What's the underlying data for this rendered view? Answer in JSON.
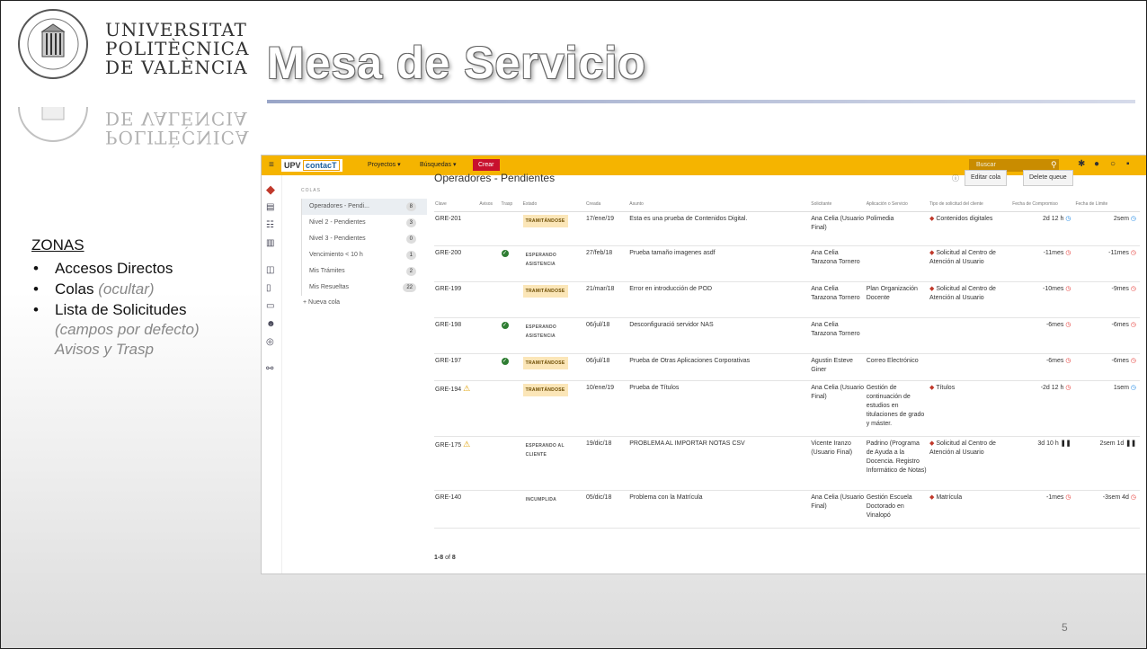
{
  "header": {
    "university_lines": [
      "UNIVERSITAT",
      "POLITÈCNICA",
      "DE VALÈNCIA"
    ],
    "seal_text": "UNIVERSITAT POLITÈCNICA DE VALÈNCIA",
    "title": "Mesa de Servicio"
  },
  "zones": {
    "heading": "ZONAS",
    "item1": "Accesos Directos",
    "item2": "Colas",
    "item2_note": "(ocultar)",
    "item3": "Lista de Solicitudes",
    "item3_note1": "(campos por defecto)",
    "item3_note2": "Avisos y Trasp"
  },
  "slide_number": "5",
  "app": {
    "brand_prefix": "UPV",
    "brand_name": "contacT",
    "nav": {
      "proyectos": "Proyectos ▾",
      "busquedas": "Búsquedas ▾",
      "crear": "Crear"
    },
    "search_placeholder": "Buscar",
    "queues_label": "COLAS",
    "queues": [
      {
        "name": "Operadores - Pendi...",
        "count": "8"
      },
      {
        "name": "Nivel 2 - Pendientes",
        "count": "3"
      },
      {
        "name": "Nivel 3 - Pendientes",
        "count": "0"
      },
      {
        "name": "Vencimiento < 10 h",
        "count": "1"
      },
      {
        "name": "Mis Trámites",
        "count": "2"
      },
      {
        "name": "Mis Resueltas",
        "count": "22"
      }
    ],
    "new_queue": "+ Nueva cola",
    "main_title": "Operadores - Pendientes",
    "edit_button": "Editar cola",
    "delete_button": "Delete queue",
    "columns": [
      "Clave",
      "Avisos",
      "Trasp",
      "Estado",
      "Creada",
      "Asunto",
      "Solicitante",
      "Aplicación o Servicio",
      "Tipo de solicitud del cliente",
      "Fecha de Compromiso",
      "Fecha de Límite"
    ],
    "rows": [
      {
        "key": "GRE-201",
        "aviso": "",
        "trasp": "",
        "estado": "TRAMITÁNDOSE",
        "creada": "17/ene/19",
        "asunto": "Esta es una prueba de Contenidos Digital.",
        "solicitante": "Ana Celia (Usuario Final)",
        "aplicacion": "Polimedia",
        "tipo": "Contenidos digitales",
        "compromiso": "2d 12 h",
        "limite": "2sem"
      },
      {
        "key": "GRE-200",
        "aviso": "",
        "trasp": "ok",
        "estado": "ESPERANDO ASISTENCIA",
        "creada": "27/feb/18",
        "asunto": "Prueba tamaño imagenes asdf",
        "solicitante": "Ana Celia Tarazona Tornero",
        "aplicacion": "",
        "tipo": "Solicitud al Centro de Atención al Usuario",
        "compromiso": "-11mes",
        "limite": "-11mes"
      },
      {
        "key": "GRE-199",
        "aviso": "",
        "trasp": "",
        "estado": "TRAMITÁNDOSE",
        "creada": "21/mar/18",
        "asunto": "Error en introducción de POD",
        "solicitante": "Ana Celia Tarazona Tornero",
        "aplicacion": "Plan Organización Docente",
        "tipo": "Solicitud al Centro de Atención al Usuario",
        "compromiso": "-10mes",
        "limite": "-9mes"
      },
      {
        "key": "GRE-198",
        "aviso": "",
        "trasp": "ok",
        "estado": "ESPERANDO ASISTENCIA",
        "creada": "06/jul/18",
        "asunto": "Desconfiguració servidor NAS",
        "solicitante": "Ana Celia Tarazona Tornero",
        "aplicacion": "",
        "tipo": "",
        "compromiso": "-6mes",
        "limite": "-6mes"
      },
      {
        "key": "GRE-197",
        "aviso": "",
        "trasp": "ok",
        "estado": "TRAMITÁNDOSE",
        "creada": "06/jul/18",
        "asunto": "Prueba de Otras Aplicaciones Corporativas",
        "solicitante": "Agustin Esteve Giner",
        "aplicacion": "Correo Electrónico",
        "tipo": "",
        "compromiso": "-6mes",
        "limite": "-6mes"
      },
      {
        "key": "GRE-194",
        "aviso": "warn",
        "trasp": "",
        "estado": "TRAMITÁNDOSE",
        "creada": "10/ene/19",
        "asunto": "Prueba de Títulos",
        "solicitante": "Ana Celia (Usuario Final)",
        "aplicacion": "Gestión de continuación de estudios en titulaciones de grado y máster.",
        "tipo": "Títulos",
        "compromiso": "-2d 12 h",
        "limite": "1sem"
      },
      {
        "key": "GRE-175",
        "aviso": "warn",
        "trasp": "",
        "estado": "ESPERANDO AL CLIENTE",
        "creada": "19/dic/18",
        "asunto": "PROBLEMA AL IMPORTAR NOTAS CSV",
        "solicitante": "Vicente Iranzo (Usuario Final)",
        "aplicacion": "Padrino (Programa de Ayuda a la Docencia. Registro Informático de Notas)",
        "tipo": "Solicitud al Centro de Atención al Usuario",
        "compromiso": "3d 10 h",
        "limite": "2sem 1d"
      },
      {
        "key": "GRE-140",
        "aviso": "",
        "trasp": "",
        "estado": "INCUMPLIDA",
        "creada": "05/dic/18",
        "asunto": "Problema con la Matrícula",
        "solicitante": "Ana Celia (Usuario Final)",
        "aplicacion": "Gestión Escuela Doctorado en Vinalopó",
        "tipo": "Matrícula",
        "compromiso": "-1mes",
        "limite": "-3sem 4d"
      }
    ],
    "pagination_range": "1-8",
    "pagination_of": "of",
    "pagination_total": "8"
  }
}
